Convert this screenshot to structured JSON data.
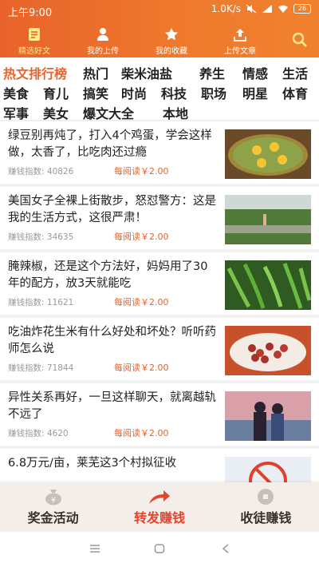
{
  "status_bar": {
    "time": "上午9:00",
    "net_speed": "1.0K/s",
    "battery": "26"
  },
  "top_nav": {
    "items": [
      {
        "label": "精选好文",
        "icon": "document-icon",
        "active": true
      },
      {
        "label": "我的上传",
        "icon": "person-icon",
        "active": false
      },
      {
        "label": "我的收藏",
        "icon": "star-icon",
        "active": false
      },
      {
        "label": "上传文章",
        "icon": "upload-icon",
        "active": false
      }
    ],
    "search_icon": "search-icon"
  },
  "categories": [
    "热文排行榜",
    "热门",
    "柴米油盐",
    "养生",
    "情感",
    "生活",
    "美食",
    "育儿",
    "搞笑",
    "时尚",
    "科技",
    "职场",
    "明星",
    "体育",
    "军事",
    "美女",
    "爆文大全",
    "本地"
  ],
  "feed": {
    "earn_label": "赚钱指数:",
    "reward_label": "每阅读￥2.00",
    "articles": [
      {
        "title": "绿豆别再炖了，打入4个鸡蛋，学会这样做，太香了，比吃肉还过瘾",
        "index": "40826",
        "reward": "每阅读￥2.00"
      },
      {
        "title": "美国女子全裸上街散步，怒怼警方：这是我的生活方式，这很严肃！",
        "index": "34635",
        "reward": "每阅读￥2.00"
      },
      {
        "title": "腌辣椒，还是这个方法好，妈妈用了30年的配方，放3天就能吃",
        "index": "11621",
        "reward": "每阅读￥2.00"
      },
      {
        "title": "吃油炸花生米有什么好处和坏处？听听药师怎么说",
        "index": "71844",
        "reward": "每阅读￥2.00"
      },
      {
        "title": "异性关系再好，一旦这样聊天，就离越轨不远了",
        "index": "4620",
        "reward": "每阅读￥2.00"
      },
      {
        "title": "6.8万元/亩，莱芜这3个村拟征收",
        "index": "",
        "reward": ""
      }
    ]
  },
  "bottom_actions": [
    {
      "label": "奖金活动",
      "icon": "money-bag-icon"
    },
    {
      "label": "转发赚钱",
      "icon": "share-arrow-icon"
    },
    {
      "label": "收徒赚钱",
      "icon": "coin-icon"
    }
  ],
  "colors": {
    "brand_orange": "#e8632b",
    "active_nav_label": "#ffe98a",
    "reward_red": "#e8632b"
  }
}
